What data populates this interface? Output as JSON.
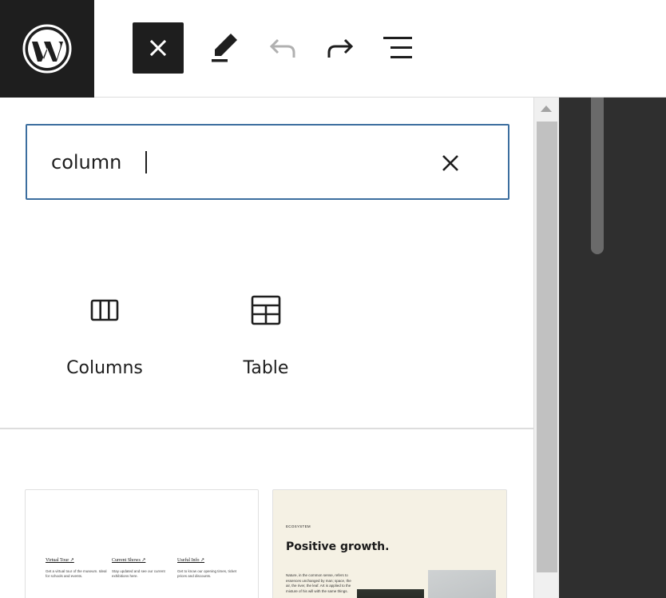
{
  "toolbar": {
    "logo_icon": "wordpress-logo-icon",
    "close_icon": "close-icon",
    "tools_icon": "pencil-icon",
    "undo_icon": "undo-icon",
    "redo_icon": "redo-icon",
    "list_view_icon": "list-view-icon"
  },
  "inserter": {
    "search": {
      "value": "column",
      "clear_icon": "close-icon"
    },
    "blocks": [
      {
        "label": "Columns",
        "icon": "columns-icon"
      },
      {
        "label": "Table",
        "icon": "table-icon"
      }
    ],
    "patterns": [
      {
        "columns": [
          {
            "heading": "Virtual Tour ↗",
            "text": "Get a virtual tour of the museum. Ideal for schools and events."
          },
          {
            "heading": "Current Shows ↗",
            "text": "Stay updated and see our current exhibitions here."
          },
          {
            "heading": "Useful Info ↗",
            "text": "Get to know our opening times, ticket prices and discounts."
          }
        ]
      },
      {
        "eyebrow": "ECOSYSTEM",
        "title": "Positive growth.",
        "body": "Nature, in the common sense, refers to essences unchanged by man; space, the air, the river, the leaf. Art is applied to the mixture of his will with the same things."
      }
    ]
  },
  "colors": {
    "dark": "#1e1e1e",
    "focus_border": "#3c6e9f",
    "canvas": "#2f2f2f",
    "pattern_cream": "#f5f1e4"
  }
}
